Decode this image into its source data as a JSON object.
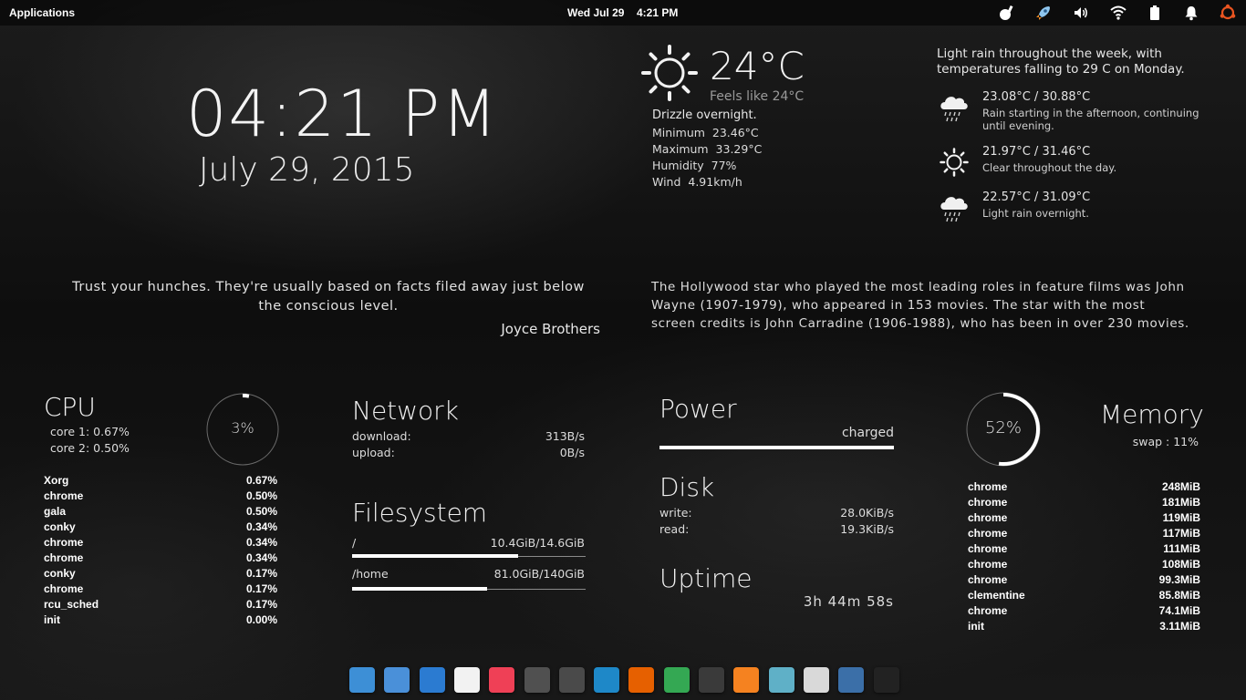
{
  "panel": {
    "applications_label": "Applications",
    "date": "Wed Jul 29",
    "time": "4:21 PM",
    "tray_icons": [
      "cleaner-icon",
      "rocket-icon",
      "volume-icon",
      "wifi-icon",
      "battery-icon",
      "notification-bell-icon",
      "ubuntu-icon"
    ]
  },
  "clock": {
    "time": "04:21 PM",
    "date": "July 29, 2015"
  },
  "weather": {
    "temperature": "24°C",
    "feels_like": "Feels like 24°C",
    "condition": "Drizzle overnight.",
    "minimum_label": "Minimum",
    "minimum": "23.46°C",
    "maximum_label": "Maximum",
    "maximum": "33.29°C",
    "humidity_label": "Humidity",
    "humidity": "77%",
    "wind_label": "Wind",
    "wind": "4.91km/h",
    "summary": "Light rain throughout the week, with temperatures falling to 29 C on Monday.",
    "forecast": [
      {
        "icon": "rain-cloud-icon",
        "temps": "23.08°C / 30.88°C",
        "desc": "Rain starting in the afternoon, continuing until evening."
      },
      {
        "icon": "sun-icon",
        "temps": "21.97°C / 31.46°C",
        "desc": "Clear throughout the day."
      },
      {
        "icon": "rain-cloud-icon",
        "temps": "22.57°C / 31.09°C",
        "desc": "Light rain overnight."
      }
    ]
  },
  "quote": {
    "text": "Trust your hunches. They're usually based on facts filed away just below the conscious level.",
    "author": "Joyce Brothers"
  },
  "fact": {
    "text": "The Hollywood star who played the most leading roles in feature films was John Wayne (1907-1979), who appeared in 153 movies. The star with the most screen credits is John Carradine (1906-1988), who has been in over 230 movies."
  },
  "cpu": {
    "title": "CPU",
    "core1": "core 1: 0.67%",
    "core2": "core 2: 0.50%",
    "usage_label": "3%",
    "usage_fraction": 0.03,
    "processes": [
      {
        "name": "Xorg",
        "value": "0.67%"
      },
      {
        "name": "chrome",
        "value": "0.50%"
      },
      {
        "name": "gala",
        "value": "0.50%"
      },
      {
        "name": "conky",
        "value": "0.34%"
      },
      {
        "name": "chrome",
        "value": "0.34%"
      },
      {
        "name": "chrome",
        "value": "0.34%"
      },
      {
        "name": "conky",
        "value": "0.17%"
      },
      {
        "name": "chrome",
        "value": "0.17%"
      },
      {
        "name": "rcu_sched",
        "value": "0.17%"
      },
      {
        "name": "init",
        "value": "0.00%"
      }
    ]
  },
  "network": {
    "title": "Network",
    "download_label": "download:",
    "download": "313B/s",
    "upload_label": "upload:",
    "upload": "0B/s"
  },
  "filesystem": {
    "title": "Filesystem",
    "mounts": [
      {
        "path": "/",
        "usage": "10.4GiB/14.6GiB",
        "fraction": 0.71
      },
      {
        "path": "/home",
        "usage": "81.0GiB/140GiB",
        "fraction": 0.58
      }
    ]
  },
  "power": {
    "title": "Power",
    "status": "charged",
    "fraction": 1.0
  },
  "disk": {
    "title": "Disk",
    "write_label": "write:",
    "write": "28.0KiB/s",
    "read_label": "read:",
    "read": "19.3KiB/s"
  },
  "uptime": {
    "title": "Uptime",
    "value": "3h 44m 58s"
  },
  "memory": {
    "title": "Memory",
    "swap": "swap : 11%",
    "usage_label": "52%",
    "usage_fraction": 0.52,
    "processes": [
      {
        "name": "chrome",
        "value": "248MiB"
      },
      {
        "name": "chrome",
        "value": "181MiB"
      },
      {
        "name": "chrome",
        "value": "119MiB"
      },
      {
        "name": "chrome",
        "value": "117MiB"
      },
      {
        "name": "chrome",
        "value": "111MiB"
      },
      {
        "name": "chrome",
        "value": "108MiB"
      },
      {
        "name": "chrome",
        "value": "99.3MiB"
      },
      {
        "name": "clementine",
        "value": "85.8MiB"
      },
      {
        "name": "chrome",
        "value": "74.1MiB"
      },
      {
        "name": "init",
        "value": "3.11MiB"
      }
    ]
  },
  "dock": {
    "apps": [
      {
        "name": "multitasking-view-icon",
        "color": "#3d8fd6"
      },
      {
        "name": "files-icon",
        "color": "#4a90d9"
      },
      {
        "name": "settings-icon",
        "color": "#2b7bd1"
      },
      {
        "name": "app-grid-icon",
        "color": "#f2f2f2"
      },
      {
        "name": "pocket-icon",
        "color": "#ef4056"
      },
      {
        "name": "writer-icon",
        "color": "#505050"
      },
      {
        "name": "sublime-text-icon",
        "color": "#4a4a4a"
      },
      {
        "name": "downloader-icon",
        "color": "#1e88c8"
      },
      {
        "name": "firefox-icon",
        "color": "#e66000"
      },
      {
        "name": "chrome-icon",
        "color": "#34a853"
      },
      {
        "name": "books-icon",
        "color": "#3a3a3a"
      },
      {
        "name": "clementine-icon",
        "color": "#f58220"
      },
      {
        "name": "atom-icon",
        "color": "#5fb0c7"
      },
      {
        "name": "mail-icon",
        "color": "#d9d9d9"
      },
      {
        "name": "tasks-icon",
        "color": "#3b6fa8"
      },
      {
        "name": "terminal-icon",
        "color": "#222222"
      }
    ]
  }
}
